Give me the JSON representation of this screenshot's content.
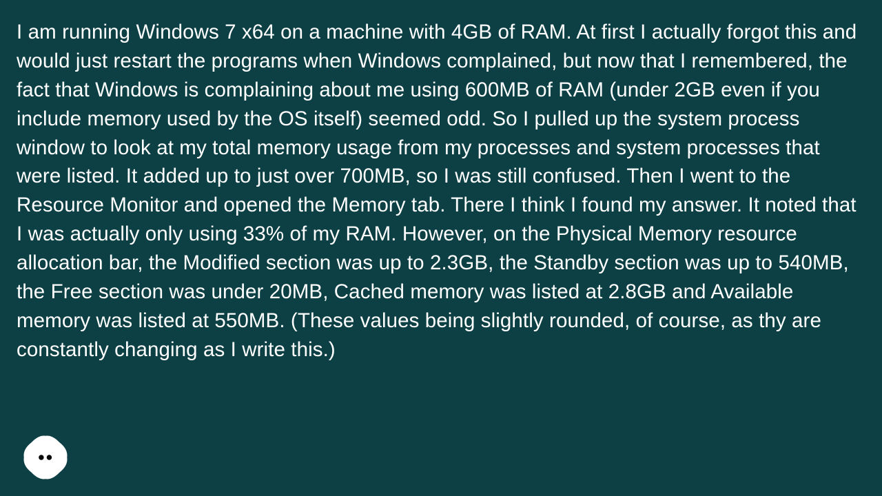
{
  "paragraph": "I am running Windows 7 x64 on a machine with 4GB of RAM. At first I actually forgot this and would just restart the programs when Windows complained, but now that I remembered, the fact that Windows is complaining about me using 600MB of RAM (under 2GB even if you include memory used by the OS itself) seemed odd. So I pulled up the system process window to look at my total memory usage from my processes and system processes that were listed. It added up to just over 700MB, so I was still confused. Then I went to the Resource Monitor and opened the Memory tab. There I think I found my answer. It noted that I was actually only using 33% of my RAM. However, on the Physical Memory resource allocation bar, the Modified section was up to 2.3GB, the Standby section was up to 540MB, the Free section was under 20MB, Cached memory was listed at 2.8GB and Available memory was listed at 550MB. (These values being slightly rounded, of course, as thy are constantly changing as I write this.)",
  "avatar": {
    "name": "speaker-avatar"
  }
}
